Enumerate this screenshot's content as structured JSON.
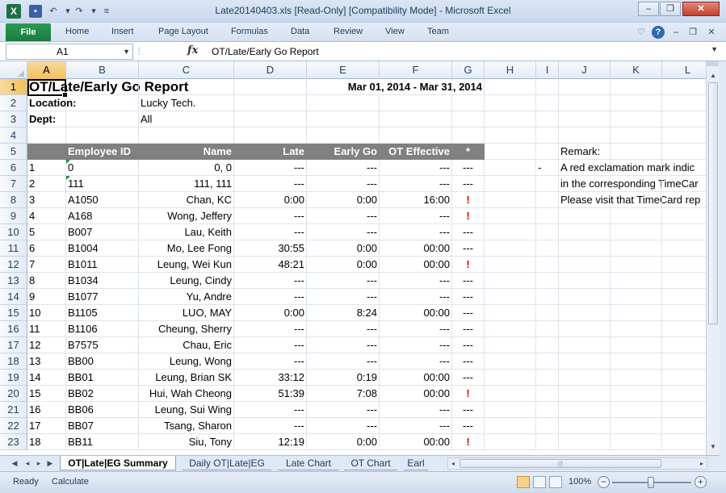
{
  "window": {
    "title": "Late20140403.xls  [Read-Only]  [Compatibility Mode]  -  Microsoft Excel",
    "app_icon": "excel-icon",
    "minimize": "–",
    "restore": "❐",
    "close": "✕"
  },
  "ribbon": {
    "file_tab": "File",
    "tabs": [
      "Home",
      "Insert",
      "Page Layout",
      "Formulas",
      "Data",
      "Review",
      "View",
      "Team"
    ]
  },
  "formula_bar": {
    "name_box": "A1",
    "fx": "fx",
    "formula": "OT/Late/Early Go Report"
  },
  "columns": [
    "A",
    "B",
    "C",
    "D",
    "E",
    "F",
    "G",
    "H",
    "I",
    "J",
    "K",
    "L"
  ],
  "selected_column": "A",
  "selected_row": 1,
  "report": {
    "title": "OT/Late/Early Go Report",
    "date_range": "Mar 01, 2014 - Mar 31, 2014",
    "location_label": "Location:",
    "location_value": "Lucky Tech.",
    "dept_label": "Dept:",
    "dept_value": "All",
    "headers": [
      "Employee ID",
      "Name",
      "Late",
      "Early Go",
      "OT Effective",
      "*"
    ],
    "rows": [
      {
        "no": "1",
        "id": "0",
        "name": "0, 0",
        "late": "---",
        "early": "---",
        "ot": "---",
        "flag": "---"
      },
      {
        "no": "2",
        "id": "111",
        "name": "111, 111",
        "late": "---",
        "early": "---",
        "ot": "---",
        "flag": "---"
      },
      {
        "no": "3",
        "id": "A1050",
        "name": "Chan, KC",
        "late": "0:00",
        "early": "0:00",
        "ot": "16:00",
        "flag": "!"
      },
      {
        "no": "4",
        "id": "A168",
        "name": "Wong, Jeffery",
        "late": "---",
        "early": "---",
        "ot": "---",
        "flag": "!"
      },
      {
        "no": "5",
        "id": "B007",
        "name": "Lau, Keith",
        "late": "---",
        "early": "---",
        "ot": "---",
        "flag": "---"
      },
      {
        "no": "6",
        "id": "B1004",
        "name": "Mo, Lee Fong",
        "late": "30:55",
        "early": "0:00",
        "ot": "00:00",
        "flag": "---"
      },
      {
        "no": "7",
        "id": "B1011",
        "name": "Leung, Wei Kun",
        "late": "48:21",
        "early": "0:00",
        "ot": "00:00",
        "flag": "!"
      },
      {
        "no": "8",
        "id": "B1034",
        "name": "Leung, Cindy",
        "late": "---",
        "early": "---",
        "ot": "---",
        "flag": "---"
      },
      {
        "no": "9",
        "id": "B1077",
        "name": "Yu, Andre",
        "late": "---",
        "early": "---",
        "ot": "---",
        "flag": "---"
      },
      {
        "no": "10",
        "id": "B1105",
        "name": "LUO, MAY",
        "late": "0:00",
        "early": "8:24",
        "ot": "00:00",
        "flag": "---"
      },
      {
        "no": "11",
        "id": "B1106",
        "name": "Cheung, Sherry",
        "late": "---",
        "early": "---",
        "ot": "---",
        "flag": "---"
      },
      {
        "no": "12",
        "id": "B7575",
        "name": "Chau, Eric",
        "late": "---",
        "early": "---",
        "ot": "---",
        "flag": "---"
      },
      {
        "no": "13",
        "id": "BB00",
        "name": "Leung, Wong",
        "late": "---",
        "early": "---",
        "ot": "---",
        "flag": "---"
      },
      {
        "no": "14",
        "id": "BB01",
        "name": "Leung, Brian SK",
        "late": "33:12",
        "early": "0:19",
        "ot": "00:00",
        "flag": "---"
      },
      {
        "no": "15",
        "id": "BB02",
        "name": "Hui, Wah Cheong",
        "late": "51:39",
        "early": "7:08",
        "ot": "00:00",
        "flag": "!"
      },
      {
        "no": "16",
        "id": "BB06",
        "name": "Leung, Sui Wing",
        "late": "---",
        "early": "---",
        "ot": "---",
        "flag": "---"
      },
      {
        "no": "17",
        "id": "BB07",
        "name": "Tsang, Sharon",
        "late": "---",
        "early": "---",
        "ot": "---",
        "flag": "---"
      },
      {
        "no": "18",
        "id": "BB11",
        "name": "Siu, Tony",
        "late": "12:19",
        "early": "0:00",
        "ot": "00:00",
        "flag": "!"
      }
    ],
    "remark_label": "Remark:",
    "remark_bullet": "-",
    "remark_lines": [
      "A red exclamation mark indic",
      "in the corresponding TimeCar",
      "Please visit that TimeCard rep"
    ]
  },
  "sheet_tabs": [
    "OT|Late|EG Summary",
    "Daily OT|Late|EG",
    "Late Chart",
    "OT Chart",
    "Earl"
  ],
  "active_sheet": "OT|Late|EG Summary",
  "status": {
    "ready": "Ready",
    "calculate": "Calculate",
    "zoom": "100%",
    "zoom_level_percent": 100
  },
  "colors": {
    "header_fill": "#808080",
    "exclamation": "#e10000",
    "file_tab": "#1a7a3e"
  }
}
